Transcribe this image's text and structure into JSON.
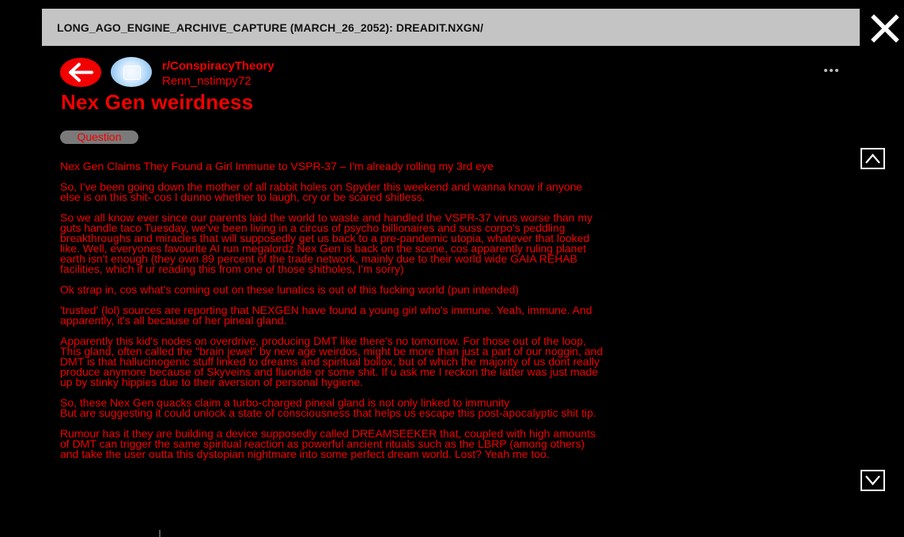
{
  "header": {
    "title": "LONG_AGO_ENGINE_ARCHIVE_CAPTURE (MARCH_26_2052): DREADIT.NXGN/"
  },
  "icons": {
    "close": "close-icon",
    "back": "arrow-left-icon",
    "more": "more-horizontal-icon",
    "scroll_up": "chevron-up-icon",
    "scroll_down": "chevron-down-icon"
  },
  "colors": {
    "accent": "#f20000",
    "background": "#000000",
    "titlebar": "#c4c4c4",
    "flair_bg": "#7a7a7a"
  },
  "post": {
    "subreddit": "r/ConspiracyTheory",
    "username": "Renn_nstimpy72",
    "title": "Nex Gen weirdness",
    "flair": "Question",
    "paragraphs": [
      [
        "Nex Gen Claims They Found a Girl Immune to VSPR-37 – I'm already rolling my 3rd eye"
      ],
      [
        "So, I've been going down the mother of all rabbit holes on Spyder this weekend and wanna know if anyone",
        "else is on this shit- cos I dunno whether to laugh, cry or be scared shitless."
      ],
      [
        "So we all know ever since our parents laid the world to waste and handled the VSPR-37 virus worse than my",
        "guts handle taco Tuesday, we've been living in a circus of psycho billionaires and suss corpo's peddling",
        "breakthroughs and miracles that will supposedly get us back to a pre-pandemic utopia, whatever that looked",
        "like. Well, everyones favourite AI run megalordz Nex Gen is back on the scene, cos apparently ruling planet",
        "earth isn't enough (they own 89 percent of the trade network, mainly due to their world wide GAIA REHAB",
        "facilities, which if ur reading this from one of those shitholes, I'm sorry)"
      ],
      [
        "Ok strap in, cos what's coming out on these lunatics is out of this fucking world (pun intended)"
      ],
      [
        "'trusted' (lol) sources are reporting that NEXGEN have found a young girl who's immune. Yeah, immune. And",
        "apparently, it's all because of her pineal gland."
      ],
      [
        "Apparently this kid's nodes on overdrive, producing DMT like there's no tomorrow. For those out of the loop,",
        "This gland, often called the \"brain jewel\" by new age weirdos, might be more than just a part of our noggin, and",
        "DMT is that hallucinogenic stuff linked to dreams and spiritual bollox, but of which the majority of us dont really",
        "produce anymore because of Skyveins and fluoride or some shit. If u ask me I reckon the latter was just made",
        "up by stinky hippies due to their aversion of personal hygiene."
      ],
      [
        "So, these Nex Gen quacks claim a turbo-charged pineal gland is not only linked to immunity",
        "But are suggesting it could unlock a state of consciousness that helps us escape this post-apocalyptic shit tip."
      ],
      [
        "Rumour has it they are building a device supposedly called DREAMSEEKER that, coupled with high amounts",
        "of DMT can trigger the same spiritual reaction as powerful ancient rituals such as the LBRP (among others)",
        "and take the user outta this dystopian nightmare into some perfect dream world. Lost? Yeah me too."
      ]
    ]
  }
}
